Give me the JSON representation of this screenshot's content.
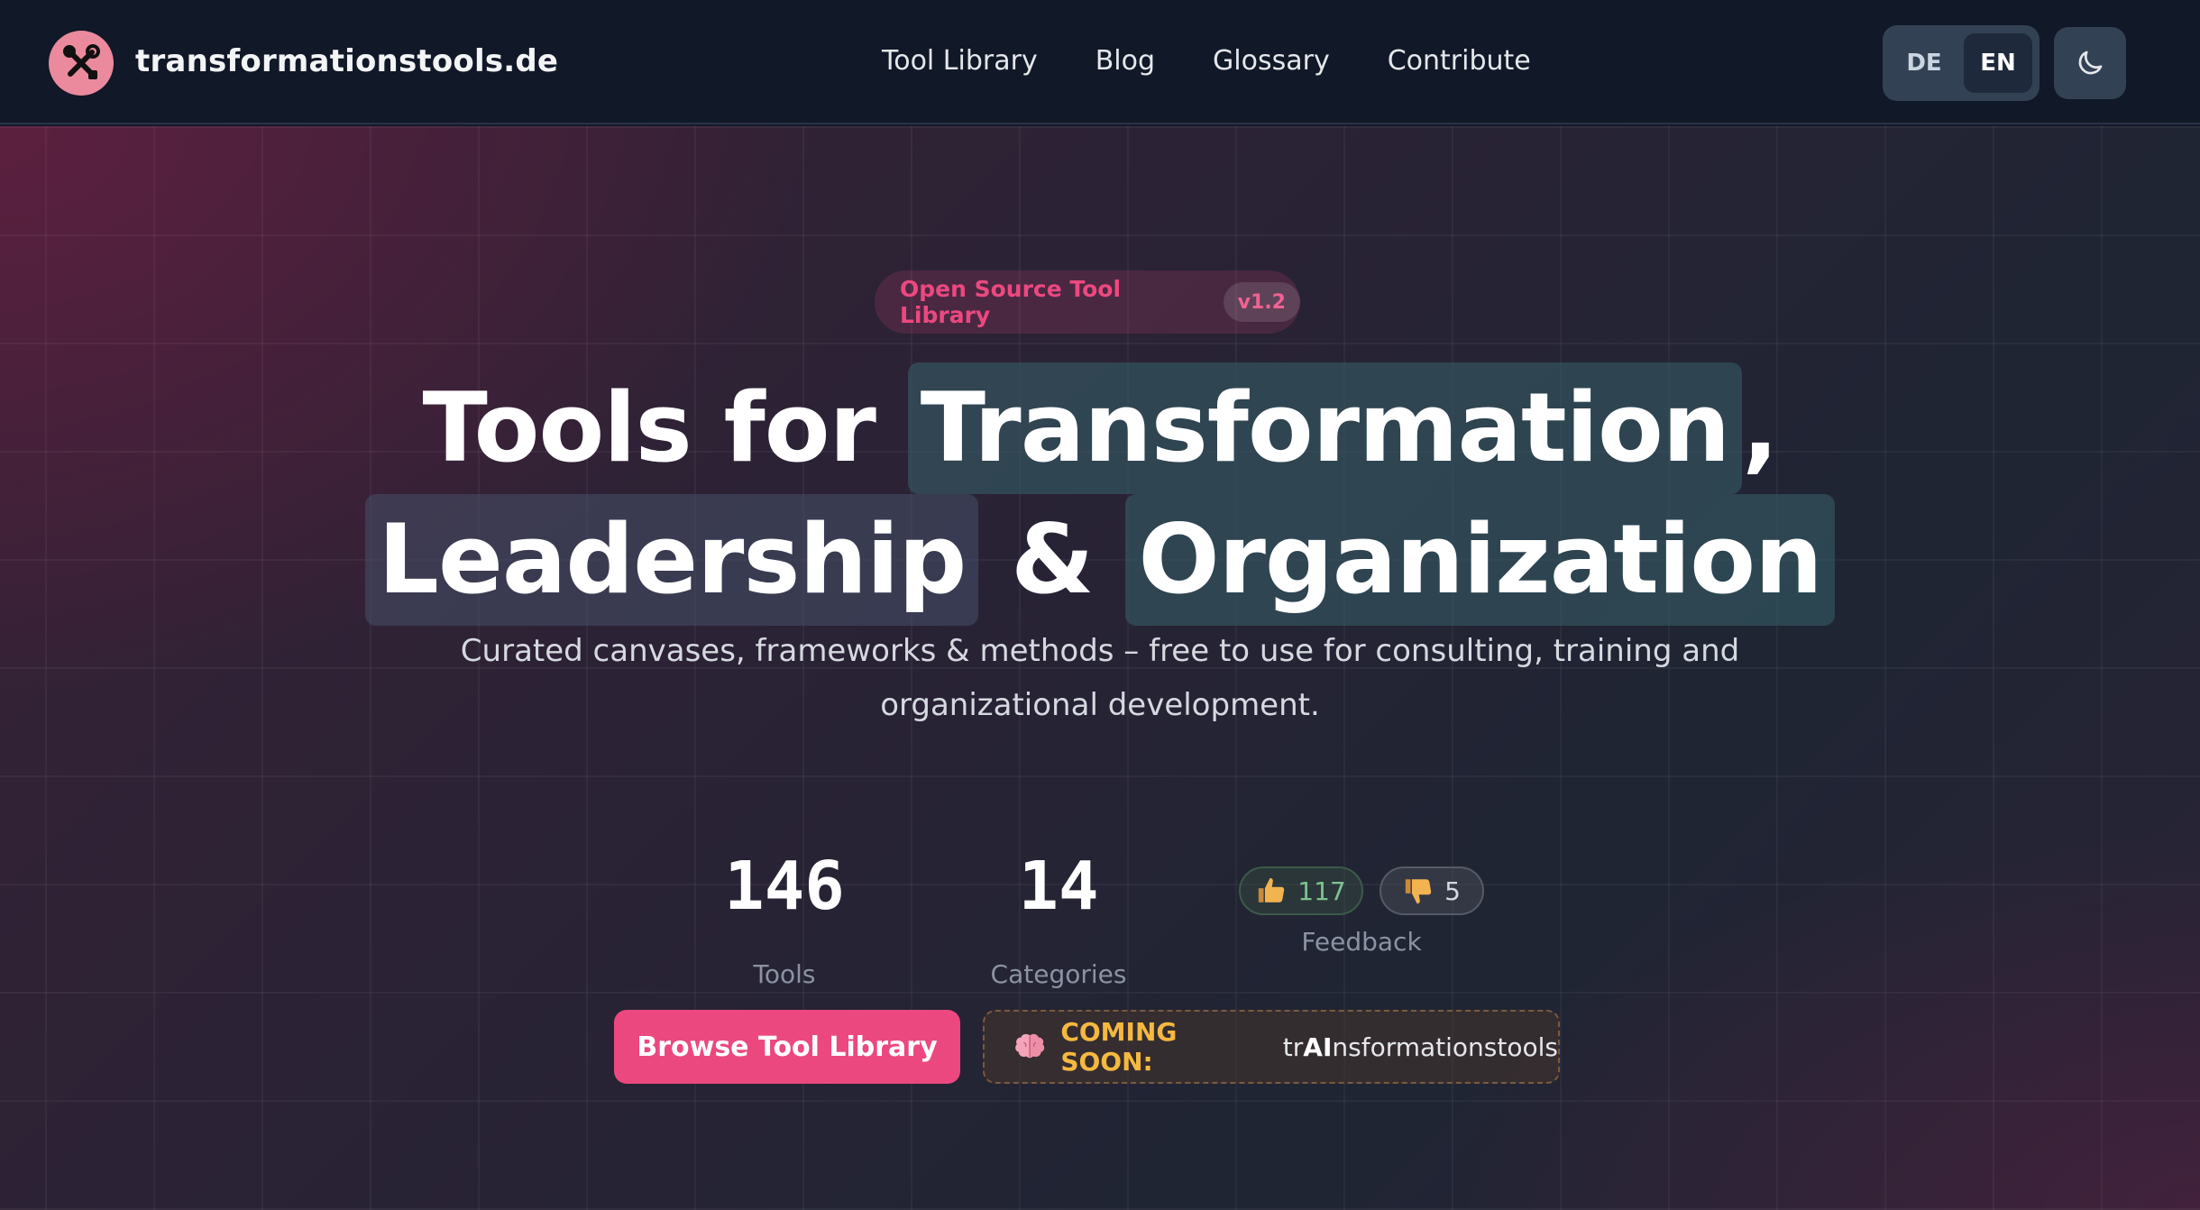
{
  "header": {
    "brand": "transformationstools.de",
    "nav": [
      "Tool Library",
      "Blog",
      "Glossary",
      "Contribute"
    ],
    "languages": [
      "DE",
      "EN"
    ],
    "active_language": "EN"
  },
  "hero": {
    "badge": {
      "label": "Open Source Tool Library",
      "version": "v1.2"
    },
    "title": {
      "line1_prefix": "Tools for ",
      "line1_highlight": "Transformation",
      "line1_suffix": ",",
      "line2_word1": "Leadership",
      "line2_amp": " & ",
      "line2_word2": "Organization"
    },
    "subtitle": "Curated canvases, frameworks & methods – free to use for consulting, training and organizational development.",
    "stats": {
      "tools": {
        "value": "146",
        "label": "Tools"
      },
      "categories": {
        "value": "14",
        "label": "Categories"
      },
      "feedback": {
        "up": "117",
        "down": "5",
        "label": "Feedback"
      }
    },
    "cta": {
      "label": "Browse Tool Library"
    },
    "coming_soon": {
      "label": "COMING SOON:",
      "name_prefix": "tr",
      "name_bold": "AI",
      "name_suffix": "nsformationstools"
    }
  },
  "colors": {
    "accent": "#ec4880",
    "header_bg": "#111827",
    "coming_soon": "#f5b940"
  },
  "icons": {
    "logo": "tools-icon",
    "theme": "moon-icon",
    "thumbs_up": "thumbs-up-icon",
    "thumbs_down": "thumbs-down-icon",
    "coming_soon": "brain-icon"
  }
}
